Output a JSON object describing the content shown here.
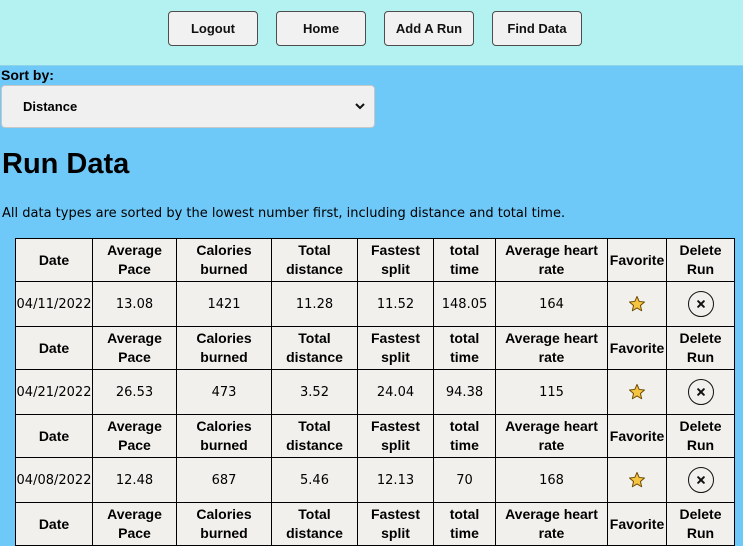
{
  "nav": {
    "logout": "Logout",
    "home": "Home",
    "add_run": "Add A Run",
    "find_data": "Find Data"
  },
  "sort": {
    "label": "Sort by:",
    "selected": "Distance"
  },
  "page": {
    "title": "Run Data",
    "note": "All data types are sorted by the lowest number first, including distance and total time."
  },
  "columns": {
    "date": "Date",
    "avg_pace": "Average Pace",
    "calories": "Calories burned",
    "distance": "Total distance",
    "fastest": "Fastest split",
    "total_time": "total time",
    "heart_rate": "Average heart rate",
    "favorite": "Favorite",
    "delete": "Delete Run"
  },
  "runs": [
    {
      "date": "04/11/2022",
      "avg_pace": "13.08",
      "calories": "1421",
      "distance": "11.28",
      "fastest": "11.52",
      "total_time": "148.05",
      "heart_rate": "164",
      "favorite_icon": "star-icon",
      "delete_icon": "close-circle-icon"
    },
    {
      "date": "04/21/2022",
      "avg_pace": "26.53",
      "calories": "473",
      "distance": "3.52",
      "fastest": "24.04",
      "total_time": "94.38",
      "heart_rate": "115",
      "favorite_icon": "star-icon",
      "delete_icon": "close-circle-icon"
    },
    {
      "date": "04/08/2022",
      "avg_pace": "12.48",
      "calories": "687",
      "distance": "5.46",
      "fastest": "12.13",
      "total_time": "70",
      "heart_rate": "168",
      "favorite_icon": "star-icon",
      "delete_icon": "close-circle-icon"
    }
  ],
  "colors": {
    "page_bg": "#6ec8f8",
    "topbar_bg": "#b4f2f2",
    "table_bg": "#f1f0ec",
    "star_fill": "#f5c542"
  }
}
